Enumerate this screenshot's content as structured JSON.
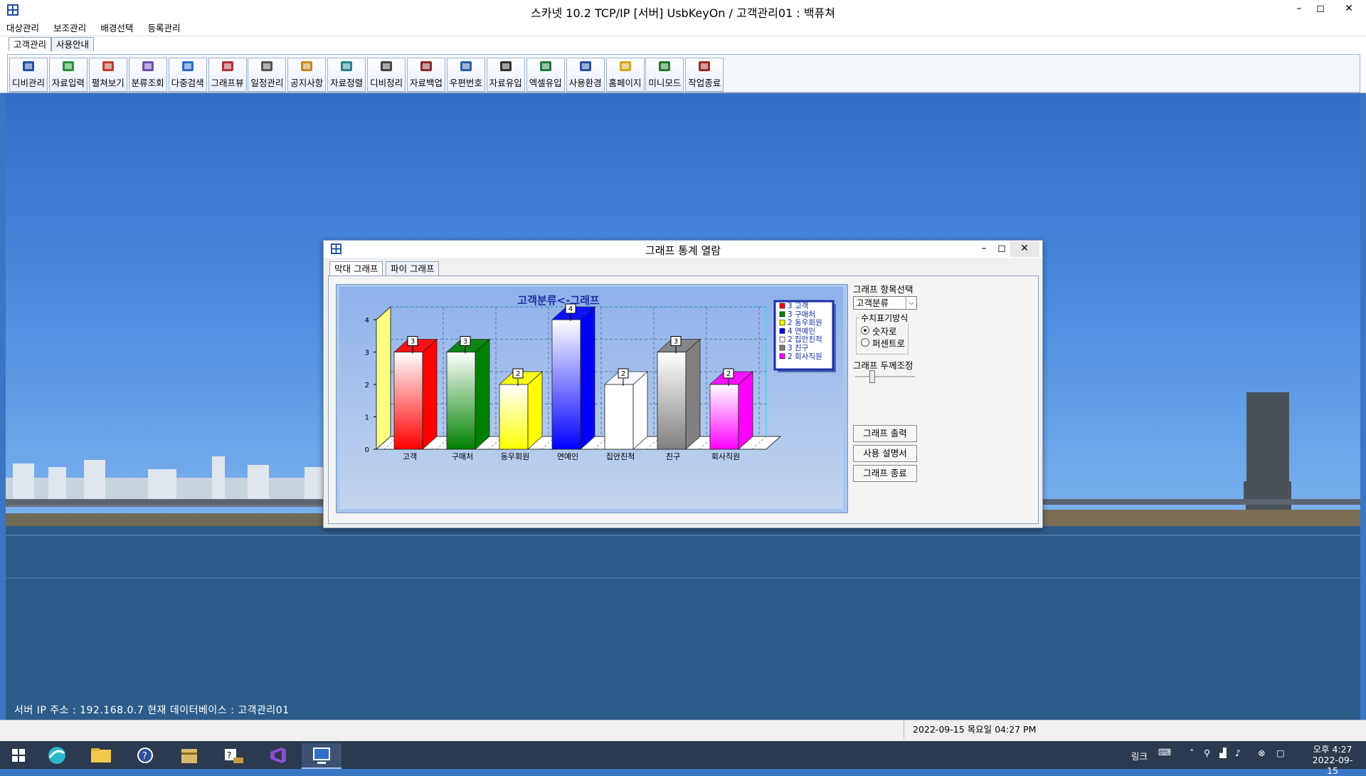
{
  "window": {
    "title": "스카넷 10.2 TCP/IP [서버] UsbKeyOn / 고객관리01 : 백퓨쳐"
  },
  "menu": [
    "대상관리",
    "보조관리",
    "배경선택",
    "등록관리"
  ],
  "tabs": [
    "고객관리",
    "사용안내"
  ],
  "toolbar": [
    {
      "label": "디비관리",
      "icon": "database-icon"
    },
    {
      "label": "자료입력",
      "icon": "edit-icon"
    },
    {
      "label": "펼쳐보기",
      "icon": "book-icon"
    },
    {
      "label": "분류조회",
      "icon": "classify-icon"
    },
    {
      "label": "다중검색",
      "icon": "search-icon"
    },
    {
      "label": "그래프뷰",
      "icon": "chart-icon"
    },
    {
      "label": "일정관리",
      "icon": "calendar-icon"
    },
    {
      "label": "공지사항",
      "icon": "notice-icon"
    },
    {
      "label": "자료정렬",
      "icon": "sort-icon"
    },
    {
      "label": "디비정리",
      "icon": "cleanup-icon"
    },
    {
      "label": "자료백업",
      "icon": "backup-icon"
    },
    {
      "label": "우편번호",
      "icon": "mail-icon"
    },
    {
      "label": "자료유입",
      "icon": "import-icon"
    },
    {
      "label": "엑셀유입",
      "icon": "excel-icon"
    },
    {
      "label": "사용환경",
      "icon": "settings-icon"
    },
    {
      "label": "홈페이지",
      "icon": "home-icon"
    },
    {
      "label": "미니모드",
      "icon": "minimode-icon"
    },
    {
      "label": "작업종료",
      "icon": "exit-icon"
    }
  ],
  "dialog": {
    "title": "그래프 통계 열람",
    "tabs": [
      "막대 그래프",
      "파이 그래프"
    ],
    "item_select_label": "그래프 항목선택",
    "item_select_value": "고객분류",
    "display_group_label": "수치표기방식",
    "radio_options": [
      "숫자로",
      "퍼센트로"
    ],
    "radio_selected": 0,
    "thickness_label": "그래프 두께조정",
    "buttons": [
      "그래프 출력",
      "사용 설명서",
      "그래프 종료"
    ]
  },
  "chart_data": {
    "type": "bar",
    "title": "고객분류<-그래프",
    "categories": [
      "고객",
      "구매처",
      "동우회원",
      "연예인",
      "집안친척",
      "친구",
      "회사직원"
    ],
    "values": [
      3,
      3,
      2,
      4,
      2,
      3,
      2
    ],
    "colors": [
      "#ff0000",
      "#008000",
      "#ffff00",
      "#0000ff",
      "#ffffff",
      "#808080",
      "#ff00ff"
    ],
    "legend": [
      "3 고객",
      "3 구매처",
      "2 동우회원",
      "4 연예인",
      "2 집안친척",
      "3 친구",
      "2 회사직원"
    ],
    "legend_position": "top-right",
    "yticks": [
      "0",
      "1",
      "2",
      "3",
      "4"
    ],
    "ylim": [
      0,
      4
    ],
    "grid": true
  },
  "desktop": {
    "server_info": "서버 IP 주소 : 192.168.0.7  현재 데이터베이스 : 고객관리01"
  },
  "statusbar": {
    "datetime": "2022-09-15 목요일 04:27 PM"
  },
  "taskbar": {
    "lang": "링크",
    "time": "오후 4:27",
    "date": "2022-09-15"
  }
}
